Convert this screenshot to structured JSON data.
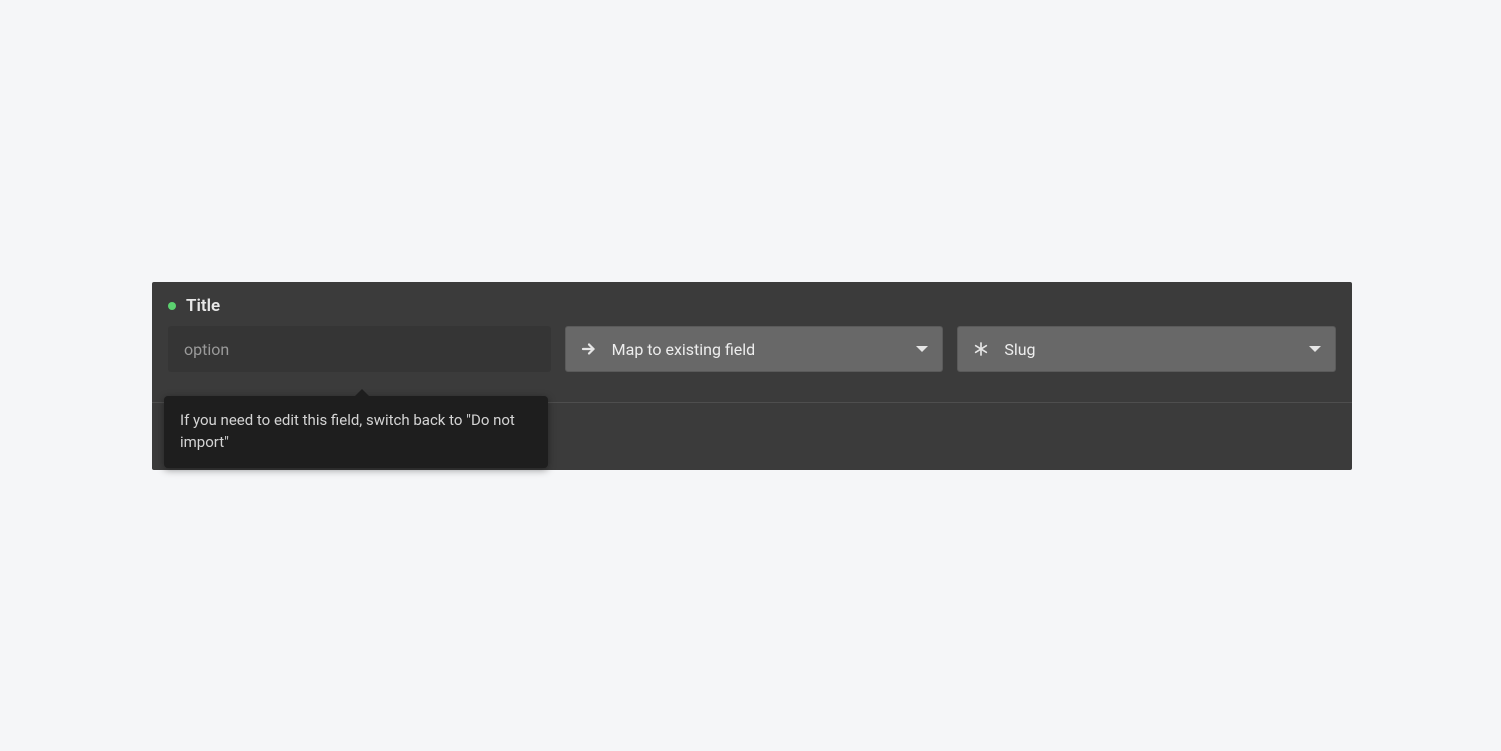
{
  "header": {
    "title": "Title",
    "status": "active"
  },
  "fields": {
    "option_input": {
      "value": "option"
    },
    "map_select": {
      "label": "Map to existing field",
      "icon": "arrow-right"
    },
    "slug_select": {
      "label": "Slug",
      "icon": "asterisk"
    }
  },
  "tooltip": {
    "text": "If you need to edit this field, switch back to \"Do not import\""
  }
}
